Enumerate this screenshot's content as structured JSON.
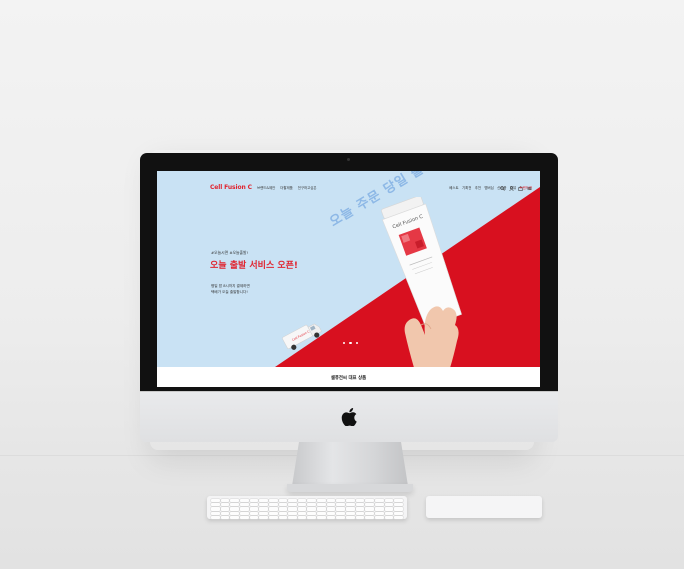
{
  "site": {
    "logo": "Cell Fusion C",
    "nav_main": [
      "브랜드&제안",
      "더할제품",
      "전구하고싶은"
    ],
    "nav_util": [
      "베스트",
      "기획전",
      "추천",
      "멤버십",
      "신상품",
      "리뷰",
      "브랜드관"
    ],
    "util_icons": [
      "search-icon",
      "user-icon",
      "bag-icon",
      "menu-icon"
    ]
  },
  "hero": {
    "hashtags": "#오늘시면 #오늘출발!",
    "headline": "오늘 출발 서비스 오픈!",
    "desc_line1": "평일 밤 8시까지 결제하면",
    "desc_line2": "택배가 오늘 출발합니다!",
    "diagonal_text": "오늘 주문 당일 출고",
    "tube_brand": "Cell Fusion C",
    "truck_brand": "Cell Fusion C",
    "slide_count": 3
  },
  "section": {
    "title": "셀퓨전씨 대표 상품"
  },
  "colors": {
    "brand_red": "#e0242f",
    "hero_blue": "#c9e2f4",
    "hero_red": "#d8101f"
  }
}
